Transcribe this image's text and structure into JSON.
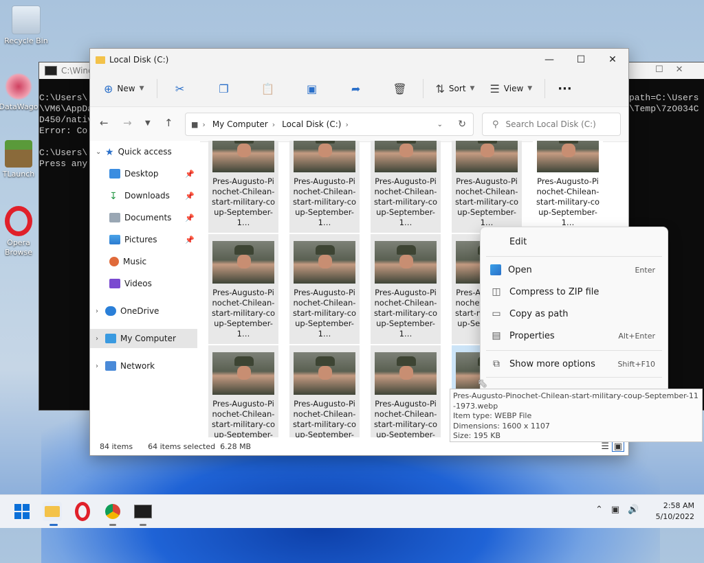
{
  "desktop": {
    "icons": [
      {
        "label": "Recycle Bin"
      },
      {
        "label": "DataWago"
      },
      {
        "label": "TLaunch"
      },
      {
        "label": "Opera Browse"
      }
    ]
  },
  "console": {
    "title": "C:\\Windo",
    "left_lines": [
      "C:\\Users\\",
      "\\VM6\\AppDa",
      "D450/nativ",
      "Error: Co",
      "",
      "C:\\Users\\",
      "Press any"
    ],
    "right_lines": [
      "path=C:\\Users",
      "\\Temp\\7zO034C"
    ]
  },
  "explorer": {
    "title": "Local Disk (C:)",
    "toolbar": {
      "new_label": "New",
      "sort_label": "Sort",
      "view_label": "View",
      "more_label": "···"
    },
    "address": {
      "crumbs": [
        "My Computer",
        "Local Disk (C:)"
      ]
    },
    "search": {
      "placeholder": "Search Local Disk (C:)"
    },
    "nav": {
      "quick_access": "Quick access",
      "items": [
        {
          "label": "Desktop",
          "pinned": true
        },
        {
          "label": "Downloads",
          "pinned": true
        },
        {
          "label": "Documents",
          "pinned": true
        },
        {
          "label": "Pictures",
          "pinned": true
        },
        {
          "label": "Music"
        },
        {
          "label": "Videos"
        }
      ],
      "onedrive": "OneDrive",
      "my_computer": "My Computer",
      "network": "Network"
    },
    "file_name_display": "Pres-Augusto-Pinochet-Chilean-start-military-coup-September-1…",
    "status": {
      "items": "84 items",
      "selected": "64 items selected  6.28 MB"
    }
  },
  "context_menu": {
    "edit": "Edit",
    "open": "Open",
    "open_shortcut": "Enter",
    "compress": "Compress to ZIP file",
    "copy_path": "Copy as path",
    "properties": "Properties",
    "properties_shortcut": "Alt+Enter",
    "more_options": "Show more options",
    "more_options_shortcut": "Shift+F10"
  },
  "tooltip": {
    "filename": "Pres-Augusto-Pinochet-Chilean-start-military-coup-September-11-1973.webp",
    "type": "Item type: WEBP File",
    "dimensions": "Dimensions: 1600 x 1107",
    "size": "Size: 195 KB"
  },
  "taskbar": {
    "time": "2:58 AM",
    "date": "5/10/2022"
  }
}
